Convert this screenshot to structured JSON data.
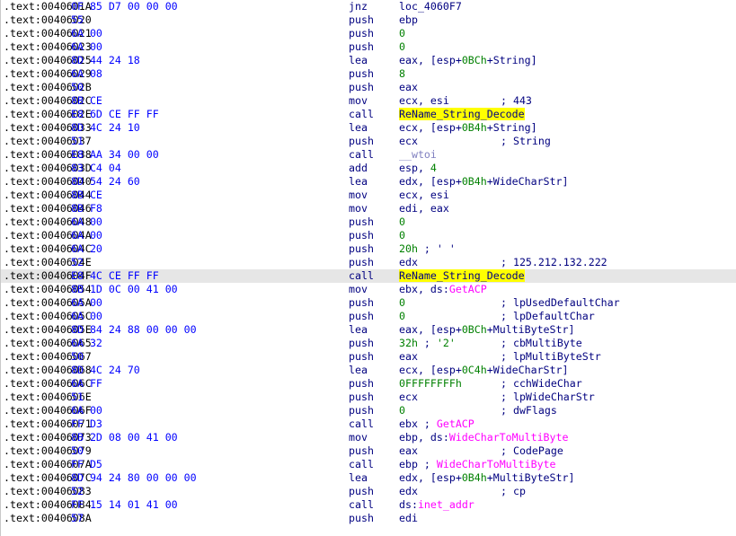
{
  "colors": {
    "background": "#ffffff",
    "address": "#000000",
    "bytes": "#0000ff",
    "mnemonic": "#000080",
    "number": "#008000",
    "import": "#ff00ff",
    "library": "#8080c0",
    "highlight": "#ffff00",
    "current_line": "#e6e6e6"
  },
  "rows": [
    {
      "addr": ".text:0040601A",
      "bytes": "0F 85 D7 00 00 00",
      "mnem": "jnz",
      "ops": [
        {
          "t": "loc_4060F7",
          "k": "sym"
        }
      ],
      "cmt": ""
    },
    {
      "addr": ".text:00406020",
      "bytes": "55",
      "mnem": "push",
      "ops": [
        {
          "t": "ebp",
          "k": "txt"
        }
      ],
      "cmt": ""
    },
    {
      "addr": ".text:00406021",
      "bytes": "6A 00",
      "mnem": "push",
      "ops": [
        {
          "t": "0",
          "k": "num"
        }
      ],
      "cmt": ""
    },
    {
      "addr": ".text:00406023",
      "bytes": "6A 00",
      "mnem": "push",
      "ops": [
        {
          "t": "0",
          "k": "num"
        }
      ],
      "cmt": ""
    },
    {
      "addr": ".text:00406025",
      "bytes": "8D 44 24 18",
      "mnem": "lea",
      "ops": [
        {
          "t": "eax, [esp+",
          "k": "txt"
        },
        {
          "t": "0BCh",
          "k": "num"
        },
        {
          "t": "+String]",
          "k": "txt"
        }
      ],
      "cmt": ""
    },
    {
      "addr": ".text:00406029",
      "bytes": "6A 08",
      "mnem": "push",
      "ops": [
        {
          "t": "8",
          "k": "num"
        }
      ],
      "cmt": ""
    },
    {
      "addr": ".text:0040602B",
      "bytes": "50",
      "mnem": "push",
      "ops": [
        {
          "t": "eax",
          "k": "txt"
        }
      ],
      "cmt": ""
    },
    {
      "addr": ".text:0040602C",
      "bytes": "8B CE",
      "mnem": "mov",
      "ops": [
        {
          "t": "ecx, esi",
          "k": "txt"
        }
      ],
      "cmt": "; 443"
    },
    {
      "addr": ".text:0040602E",
      "bytes": "E8 6D CE FF FF",
      "mnem": "call",
      "ops": [
        {
          "t": "ReName_String_Decode",
          "k": "hl"
        }
      ],
      "cmt": ""
    },
    {
      "addr": ".text:00406033",
      "bytes": "8D 4C 24 10",
      "mnem": "lea",
      "ops": [
        {
          "t": "ecx, [esp+",
          "k": "txt"
        },
        {
          "t": "0B4h",
          "k": "num"
        },
        {
          "t": "+String]",
          "k": "txt"
        }
      ],
      "cmt": ""
    },
    {
      "addr": ".text:00406037",
      "bytes": "51",
      "mnem": "push",
      "ops": [
        {
          "t": "ecx",
          "k": "txt"
        }
      ],
      "cmt": "; String"
    },
    {
      "addr": ".text:00406038",
      "bytes": "E8 AA 34 00 00",
      "mnem": "call",
      "ops": [
        {
          "t": "__wtoi",
          "k": "lib"
        }
      ],
      "cmt": ""
    },
    {
      "addr": ".text:0040603D",
      "bytes": "83 C4 04",
      "mnem": "add",
      "ops": [
        {
          "t": "esp, ",
          "k": "txt"
        },
        {
          "t": "4",
          "k": "num"
        }
      ],
      "cmt": ""
    },
    {
      "addr": ".text:00406040",
      "bytes": "8D 54 24 60",
      "mnem": "lea",
      "ops": [
        {
          "t": "edx, [esp+",
          "k": "txt"
        },
        {
          "t": "0B4h",
          "k": "num"
        },
        {
          "t": "+WideCharStr]",
          "k": "txt"
        }
      ],
      "cmt": ""
    },
    {
      "addr": ".text:00406044",
      "bytes": "8B CE",
      "mnem": "mov",
      "ops": [
        {
          "t": "ecx, esi",
          "k": "txt"
        }
      ],
      "cmt": ""
    },
    {
      "addr": ".text:00406046",
      "bytes": "8B F8",
      "mnem": "mov",
      "ops": [
        {
          "t": "edi, eax",
          "k": "txt"
        }
      ],
      "cmt": ""
    },
    {
      "addr": ".text:00406048",
      "bytes": "6A 00",
      "mnem": "push",
      "ops": [
        {
          "t": "0",
          "k": "num"
        }
      ],
      "cmt": ""
    },
    {
      "addr": ".text:0040604A",
      "bytes": "6A 00",
      "mnem": "push",
      "ops": [
        {
          "t": "0",
          "k": "num"
        }
      ],
      "cmt": ""
    },
    {
      "addr": ".text:0040604C",
      "bytes": "6A 20",
      "mnem": "push",
      "ops": [
        {
          "t": "20h",
          "k": "num"
        },
        {
          "t": " ; ' '",
          "k": "txt"
        }
      ],
      "cmt": ""
    },
    {
      "addr": ".text:0040604E",
      "bytes": "52",
      "mnem": "push",
      "ops": [
        {
          "t": "edx",
          "k": "txt"
        }
      ],
      "cmt": "; 125.212.132.222"
    },
    {
      "addr": ".text:0040604F",
      "bytes": "E8 4C CE FF FF",
      "mnem": "call",
      "ops": [
        {
          "t": "ReName_String_Decode",
          "k": "hl"
        }
      ],
      "cmt": "",
      "current": true
    },
    {
      "addr": ".text:00406054",
      "bytes": "8B 1D 0C 00 41 00",
      "mnem": "mov",
      "ops": [
        {
          "t": "ebx, ds:",
          "k": "txt"
        },
        {
          "t": "GetACP",
          "k": "imp"
        }
      ],
      "cmt": ""
    },
    {
      "addr": ".text:0040605A",
      "bytes": "6A 00",
      "mnem": "push",
      "ops": [
        {
          "t": "0",
          "k": "num"
        }
      ],
      "cmt": "; lpUsedDefaultChar"
    },
    {
      "addr": ".text:0040605C",
      "bytes": "6A 00",
      "mnem": "push",
      "ops": [
        {
          "t": "0",
          "k": "num"
        }
      ],
      "cmt": "; lpDefaultChar"
    },
    {
      "addr": ".text:0040605E",
      "bytes": "8D 84 24 88 00 00 00",
      "mnem": "lea",
      "ops": [
        {
          "t": "eax, [esp+",
          "k": "txt"
        },
        {
          "t": "0BCh",
          "k": "num"
        },
        {
          "t": "+MultiByteStr]",
          "k": "txt"
        }
      ],
      "cmt": ""
    },
    {
      "addr": ".text:00406065",
      "bytes": "6A 32",
      "mnem": "push",
      "ops": [
        {
          "t": "32h",
          "k": "num"
        },
        {
          "t": " ; ",
          "k": "txt"
        },
        {
          "t": "'2'",
          "k": "num"
        }
      ],
      "cmt": "; cbMultiByte"
    },
    {
      "addr": ".text:00406067",
      "bytes": "50",
      "mnem": "push",
      "ops": [
        {
          "t": "eax",
          "k": "txt"
        }
      ],
      "cmt": "; lpMultiByteStr"
    },
    {
      "addr": ".text:00406068",
      "bytes": "8D 4C 24 70",
      "mnem": "lea",
      "ops": [
        {
          "t": "ecx, [esp+",
          "k": "txt"
        },
        {
          "t": "0C4h",
          "k": "num"
        },
        {
          "t": "+WideCharStr]",
          "k": "txt"
        }
      ],
      "cmt": ""
    },
    {
      "addr": ".text:0040606C",
      "bytes": "6A FF",
      "mnem": "push",
      "ops": [
        {
          "t": "0FFFFFFFFh",
          "k": "num"
        }
      ],
      "cmt": "; cchWideChar"
    },
    {
      "addr": ".text:0040606E",
      "bytes": "51",
      "mnem": "push",
      "ops": [
        {
          "t": "ecx",
          "k": "txt"
        }
      ],
      "cmt": "; lpWideCharStr"
    },
    {
      "addr": ".text:0040606F",
      "bytes": "6A 00",
      "mnem": "push",
      "ops": [
        {
          "t": "0",
          "k": "num"
        }
      ],
      "cmt": "; dwFlags"
    },
    {
      "addr": ".text:00406071",
      "bytes": "FF D3",
      "mnem": "call",
      "ops": [
        {
          "t": "ebx ; ",
          "k": "txt"
        },
        {
          "t": "GetACP",
          "k": "imp"
        }
      ],
      "cmt": ""
    },
    {
      "addr": ".text:00406073",
      "bytes": "8B 2D 08 00 41 00",
      "mnem": "mov",
      "ops": [
        {
          "t": "ebp, ds:",
          "k": "txt"
        },
        {
          "t": "WideCharToMultiByte",
          "k": "imp"
        }
      ],
      "cmt": ""
    },
    {
      "addr": ".text:00406079",
      "bytes": "50",
      "mnem": "push",
      "ops": [
        {
          "t": "eax",
          "k": "txt"
        }
      ],
      "cmt": "; CodePage"
    },
    {
      "addr": ".text:0040607A",
      "bytes": "FF D5",
      "mnem": "call",
      "ops": [
        {
          "t": "ebp ; ",
          "k": "txt"
        },
        {
          "t": "WideCharToMultiByte",
          "k": "imp"
        }
      ],
      "cmt": ""
    },
    {
      "addr": ".text:0040607C",
      "bytes": "8D 94 24 80 00 00 00",
      "mnem": "lea",
      "ops": [
        {
          "t": "edx, [esp+",
          "k": "txt"
        },
        {
          "t": "0B4h",
          "k": "num"
        },
        {
          "t": "+MultiByteStr]",
          "k": "txt"
        }
      ],
      "cmt": ""
    },
    {
      "addr": ".text:00406083",
      "bytes": "52",
      "mnem": "push",
      "ops": [
        {
          "t": "edx",
          "k": "txt"
        }
      ],
      "cmt": "; cp"
    },
    {
      "addr": ".text:00406084",
      "bytes": "FF 15 14 01 41 00",
      "mnem": "call",
      "ops": [
        {
          "t": "ds:",
          "k": "txt"
        },
        {
          "t": "inet_addr",
          "k": "imp"
        }
      ],
      "cmt": ""
    },
    {
      "addr": ".text:0040608A",
      "bytes": "57",
      "mnem": "push",
      "ops": [
        {
          "t": "edi",
          "k": "txt"
        }
      ],
      "cmt": ""
    }
  ]
}
